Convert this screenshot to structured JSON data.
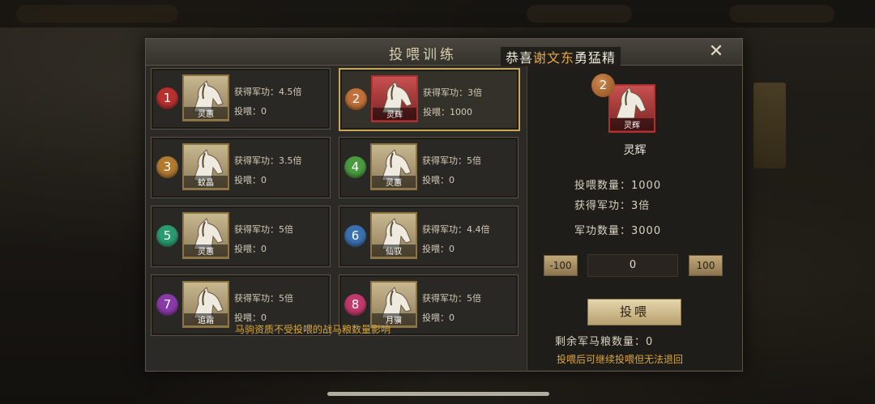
{
  "dialog": {
    "title": "投喂训练",
    "close_icon": "close-icon",
    "congrats": {
      "prefix": "恭喜",
      "name": "谢文东",
      "suffix": "勇猛精"
    }
  },
  "horses": [
    {
      "num": "1",
      "name": "灵蕙",
      "merit_label": "获得军功：",
      "merit": "4.5倍",
      "fed_label": "投喂：",
      "fed": "0",
      "color": "#b83030",
      "frame": "gold"
    },
    {
      "num": "2",
      "name": "灵辉",
      "merit_label": "获得军功：",
      "merit": "3倍",
      "fed_label": "投喂：",
      "fed": "1000",
      "color": "#c07038",
      "frame": "red",
      "selected": true
    },
    {
      "num": "3",
      "name": "蚊晶",
      "merit_label": "获得军功：",
      "merit": "3.5倍",
      "fed_label": "投喂：",
      "fed": "0",
      "color": "#b07a30",
      "frame": "gold"
    },
    {
      "num": "4",
      "name": "灵蕙",
      "merit_label": "获得军功：",
      "merit": "5倍",
      "fed_label": "投喂：",
      "fed": "0",
      "color": "#4a9a40",
      "frame": "gold"
    },
    {
      "num": "5",
      "name": "灵蕙",
      "merit_label": "获得军功：",
      "merit": "5倍",
      "fed_label": "投喂：",
      "fed": "0",
      "color": "#2a9a70",
      "frame": "gold"
    },
    {
      "num": "6",
      "name": "仙驭",
      "merit_label": "获得军功：",
      "merit": "4.4倍",
      "fed_label": "投喂：",
      "fed": "0",
      "color": "#3a70b0",
      "frame": "gold"
    },
    {
      "num": "7",
      "name": "追霜",
      "merit_label": "获得军功：",
      "merit": "5倍",
      "fed_label": "投喂：",
      "fed": "0",
      "color": "#8a3aa8",
      "frame": "gold"
    },
    {
      "num": "8",
      "name": "月骥",
      "merit_label": "获得军功：",
      "merit": "5倍",
      "fed_label": "投喂：",
      "fed": "0",
      "color": "#c03a6a",
      "frame": "gold"
    }
  ],
  "footnote": "马驹资质不受投喂的战马粮数量影响",
  "detail": {
    "num": "2",
    "name": "灵辉",
    "feed_count": "投喂数量：1000",
    "merit": "获得军功：3倍",
    "merit_total": "军功数量：3000",
    "minus_label": "-100",
    "plus_label": "100",
    "qty": "0",
    "feed_button": "投喂",
    "remaining": "剩余军马粮数量：0",
    "note": "投喂后可继续投喂但无法退回"
  }
}
